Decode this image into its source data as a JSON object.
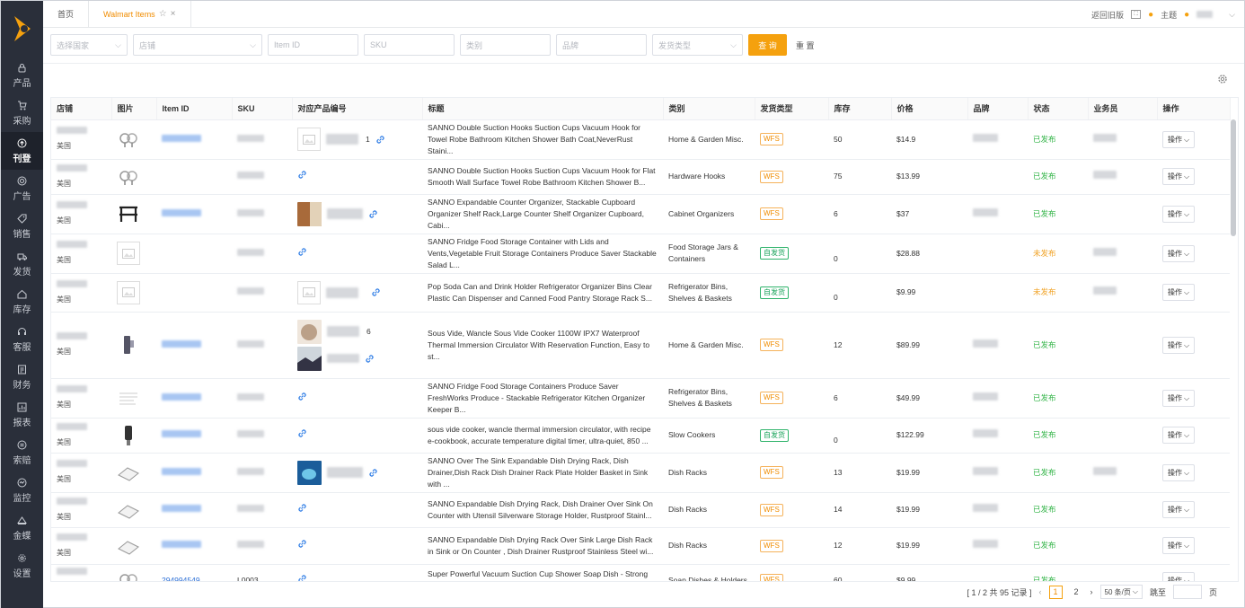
{
  "sidebar": {
    "items": [
      {
        "label": "产品",
        "icon": "lock-icon"
      },
      {
        "label": "采购",
        "icon": "cart-icon"
      },
      {
        "label": "刊登",
        "icon": "upload-icon"
      },
      {
        "label": "广告",
        "icon": "target-icon"
      },
      {
        "label": "销售",
        "icon": "tag-icon"
      },
      {
        "label": "发货",
        "icon": "truck-icon"
      },
      {
        "label": "库存",
        "icon": "home-icon"
      },
      {
        "label": "客服",
        "icon": "headset-icon"
      },
      {
        "label": "财务",
        "icon": "ledger-icon"
      },
      {
        "label": "报表",
        "icon": "chart-icon"
      },
      {
        "label": "索赔",
        "icon": "claim-icon"
      },
      {
        "label": "监控",
        "icon": "monitor-icon"
      },
      {
        "label": "金蝶",
        "icon": "kingdee-icon"
      },
      {
        "label": "设置",
        "icon": "gear-icon"
      }
    ]
  },
  "tabs": [
    {
      "label": "首页"
    },
    {
      "label": "Walmart Items"
    }
  ],
  "topbar": {
    "back_old": "返回旧版",
    "theme": "主题"
  },
  "filters": {
    "country": "选择国家",
    "store": "店铺",
    "item_id": "Item ID",
    "sku": "SKU",
    "category": "类别",
    "brand": "品牌",
    "ship_type": "发货类型",
    "search": "查 询",
    "reset": "重 置"
  },
  "table": {
    "headers": [
      "店铺",
      "图片",
      "Item ID",
      "SKU",
      "对应产品编号",
      "标题",
      "类别",
      "发货类型",
      "库存",
      "价格",
      "品牌",
      "状态",
      "业务员",
      "操作"
    ],
    "op_label": "操作",
    "rows": [
      {
        "country": "美国",
        "title": "SANNO Double Suction Hooks Suction Cups Vacuum Hook for Towel Robe Bathroom Kitchen Shower Bath Coat,NeverRust Staini...",
        "category": "Home & Garden Misc.",
        "ship": "WFS",
        "stock": "50",
        "price": "$14.9",
        "status": "已发布",
        "prod_suffix": "1"
      },
      {
        "country": "美国",
        "title": "SANNO Double Suction Hooks Suction Cups Vacuum Hook for Flat Smooth Wall Surface Towel Robe Bathroom Kitchen Shower B...",
        "category": "Hardware Hooks",
        "ship": "WFS",
        "stock": "75",
        "price": "$13.99",
        "status": "已发布",
        "prod_suffix": ""
      },
      {
        "country": "美国",
        "title": "SANNO Expandable Counter Organizer, Stackable Cupboard Organizer Shelf Rack,Large Counter Shelf Organizer Cupboard, Cabi...",
        "category": "Cabinet Organizers",
        "ship": "WFS",
        "stock": "6",
        "price": "$37",
        "status": "已发布",
        "prod_suffix": ""
      },
      {
        "country": "美国",
        "title": "SANNO Fridge Food Storage Container with Lids and Vents,Vegetable Fruit Storage Containers Produce Saver Stackable Salad L...",
        "category": "Food Storage Jars & Containers",
        "ship": "自发货",
        "stock": "0",
        "price": "$28.88",
        "status": "未发布",
        "prod_suffix": ""
      },
      {
        "country": "美国",
        "title": "Pop Soda Can and Drink Holder Refrigerator Organizer Bins Clear Plastic Can Dispenser and Canned Food Pantry Storage Rack S...",
        "category": "Refrigerator Bins, Shelves & Baskets",
        "ship": "自发货",
        "stock": "0",
        "price": "$9.99",
        "status": "未发布",
        "prod_suffix": ""
      },
      {
        "country": "美国",
        "title": "Sous Vide, Wancle Sous Vide Cooker 1100W IPX7 Waterproof Thermal Immersion Circulator With Reservation Function, Easy to st...",
        "category": "Home & Garden Misc.",
        "ship": "WFS",
        "stock": "12",
        "price": "$89.99",
        "status": "已发布",
        "prod_suffix": "6"
      },
      {
        "country": "美国",
        "title": "SANNO Fridge Food Storage Containers Produce Saver FreshWorks Produce - Stackable Refrigerator Kitchen Organizer Keeper B...",
        "category": "Refrigerator Bins, Shelves & Baskets",
        "ship": "WFS",
        "stock": "6",
        "price": "$49.99",
        "status": "已发布",
        "prod_suffix": ""
      },
      {
        "country": "美国",
        "title": "sous vide cooker, wancle thermal immersion circulator, with recipe e-cookbook, accurate temperature digital timer, ultra-quiet, 850 ...",
        "category": "Slow Cookers",
        "ship": "自发货",
        "stock": "0",
        "price": "$122.99",
        "status": "已发布",
        "prod_suffix": ""
      },
      {
        "country": "美国",
        "title": "SANNO Over The Sink Expandable Dish Drying Rack, Dish Drainer,Dish Rack Dish Drainer Rack Plate Holder Basket in Sink with ...",
        "category": "Dish Racks",
        "ship": "WFS",
        "stock": "13",
        "price": "$19.99",
        "status": "已发布",
        "prod_suffix": ""
      },
      {
        "country": "美国",
        "title": "SANNO Expandable Dish Drying Rack, Dish Drainer Over Sink On Counter with Utensil Silverware Storage Holder, Rustproof Stainl...",
        "category": "Dish Racks",
        "ship": "WFS",
        "stock": "14",
        "price": "$19.99",
        "status": "已发布",
        "prod_suffix": ""
      },
      {
        "country": "美国",
        "title": "SANNO Expandable Dish Drying Rack Over Sink Large Dish Rack in Sink or On Counter , Dish Drainer Rustproof Stainless Steel wi...",
        "category": "Dish Racks",
        "ship": "WFS",
        "stock": "12",
        "price": "$19.99",
        "status": "已发布",
        "prod_suffix": ""
      },
      {
        "country": "美国",
        "item_id": "294994549",
        "sku": "L0003",
        "title": "Super Powerful Vacuum Suction Cup Shower Soap Dish - Strong Rustproof Stainless Steel Soap Saver Sponge Holder for Bathro...",
        "category": "Soap Dishes & Holders",
        "ship": "WFS",
        "stock": "60",
        "price": "$9.99",
        "status": "已发布",
        "prod_suffix": ""
      }
    ]
  },
  "pager": {
    "summary": "[ 1 / 2 共 95 记录 ]",
    "pages": [
      "1",
      "2"
    ],
    "page_size": "50 条/页",
    "goto_label": "跳至",
    "page_unit": "页"
  },
  "colors": {
    "accent": "#f5a10e",
    "sidebar": "#2a2f3a",
    "published": "#2fb344",
    "unpublished": "#f0a020",
    "link": "#2c6fd6"
  }
}
